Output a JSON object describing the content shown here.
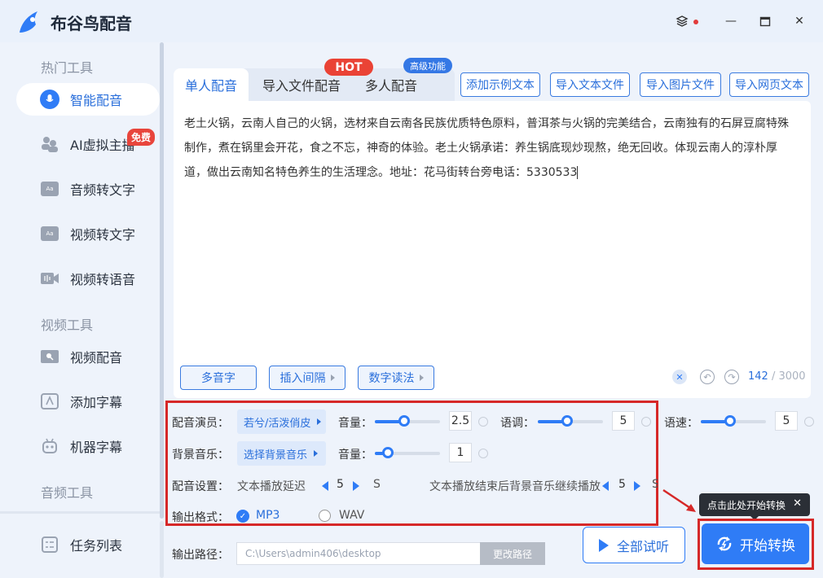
{
  "app": {
    "title": "布谷鸟配音"
  },
  "window_controls": {
    "skin_icon": "layers-icon",
    "minimize": "—",
    "maximize": "☐",
    "close": "✕"
  },
  "sidebar": {
    "sections": [
      {
        "title": "热门工具"
      },
      {
        "title": "视频工具"
      },
      {
        "title": "音频工具"
      }
    ],
    "items": [
      {
        "label": "智能配音",
        "icon": "mic-icon",
        "active": true
      },
      {
        "label": "AI虚拟主播",
        "icon": "avatar-icon",
        "badge": "免费"
      },
      {
        "label": "音频转文字",
        "icon": "audio-text-icon"
      },
      {
        "label": "视频转文字",
        "icon": "video-text-icon"
      },
      {
        "label": "视频转语音",
        "icon": "video-voice-icon"
      },
      {
        "label": "视频配音",
        "icon": "video-dub-icon"
      },
      {
        "label": "添加字幕",
        "icon": "subtitle-icon"
      },
      {
        "label": "机器字幕",
        "icon": "robot-icon"
      },
      {
        "label": "任务列表",
        "icon": "task-list-icon"
      }
    ]
  },
  "tabs": [
    {
      "label": "单人配音",
      "active": true
    },
    {
      "label": "导入文件配音",
      "badge": "HOT"
    },
    {
      "label": "多人配音",
      "badge": "高级功能"
    }
  ],
  "toolbar": {
    "add_example": "添加示例文本",
    "import_text": "导入文本文件",
    "import_image": "导入图片文件",
    "import_web": "导入网页文本"
  },
  "editor": {
    "text": "老土火锅，云南人自己的火锅，选材来自云南各民族优质特色原料，普洱茶与火锅的完美结合，云南独有的石屏豆腐特殊制作，煮在锅里会开花，食之不忘，神奇的体验。老土火锅承诺：养生锅底现炒现熬，绝无回收。体现云南人的淳朴厚道，做出云南知名特色养生的生活理念。地址：花马街转台旁电话：5330533",
    "polyphone_btn": "多音字",
    "insert_pause_btn": "插入间隔",
    "number_read_btn": "数字读法",
    "char_count": "142",
    "char_max": "/ 3000"
  },
  "settings": {
    "voice_label": "配音演员：",
    "voice_value": "若兮/活泼俏皮",
    "volume_label": "音量：",
    "volume_value": "2.5",
    "volume_level": 0.45,
    "pitch_label": "语调：",
    "pitch_value": "5",
    "pitch_level": 0.45,
    "speed_label": "语速：",
    "speed_value": "5",
    "speed_level": 0.45,
    "bgm_label": "背景音乐：",
    "bgm_value": "选择背景音乐",
    "bgm_volume_label": "音量：",
    "bgm_volume_value": "1",
    "bgm_volume_level": 0.2,
    "dub_label": "配音设置：",
    "delay_label": "文本播放延迟",
    "delay_value": "5",
    "delay_unit": "S",
    "bgm_after_label": "文本播放结束后背景音乐继续播放",
    "bgm_after_value": "5",
    "bgm_after_unit": "S",
    "format_label": "输出格式：",
    "format_mp3": "MP3",
    "format_wav": "WAV",
    "format_selected": "MP3"
  },
  "output": {
    "path_label": "输出路径：",
    "path_value": "C:\\Users\\admin406\\desktop",
    "change_path_btn": "更改路径"
  },
  "actions": {
    "preview_all": "全部试听",
    "start": "开始转换",
    "tooltip": "点击此处开始转换",
    "tooltip_close": "✕"
  },
  "colors": {
    "accent": "#2f7cf6",
    "highlight": "#d62828",
    "hot": "#ea4335"
  }
}
